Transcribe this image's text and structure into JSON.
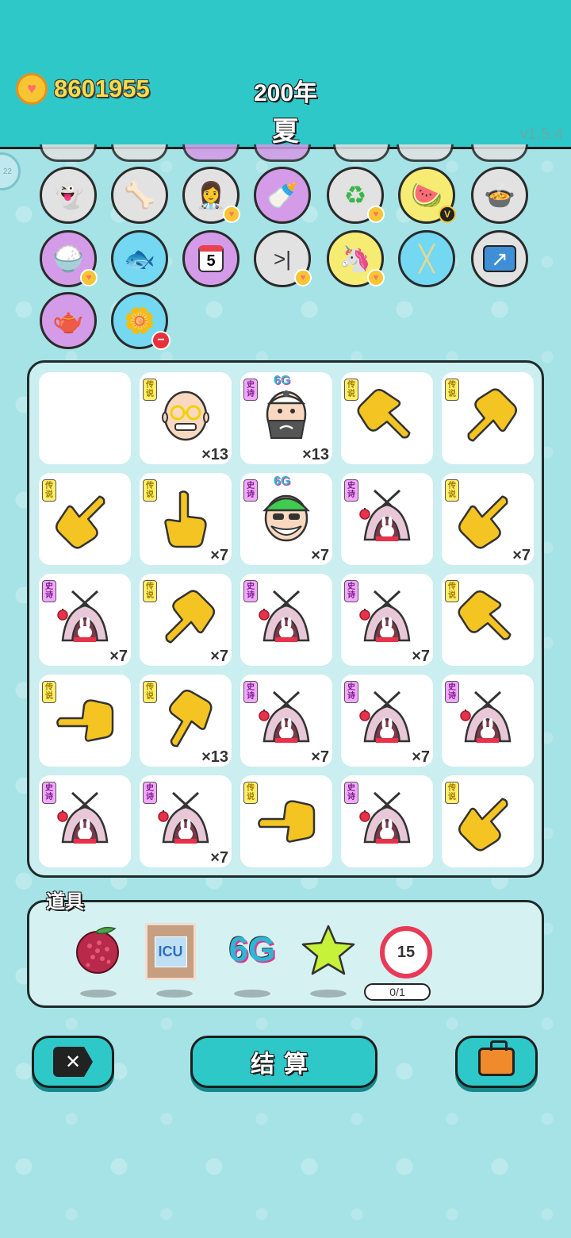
{
  "header": {
    "coins": "8601955",
    "year": "200年",
    "season": "夏",
    "version": "v1.5.4"
  },
  "side_badge": "22",
  "upgrades": [
    {
      "name": "ghost-icon",
      "glyph": "👻",
      "bg": "#e2e2e2",
      "badge": ""
    },
    {
      "name": "dog-bowl-icon",
      "glyph": "🦴",
      "bg": "#e2e2e2",
      "badge": ""
    },
    {
      "name": "nurses-icon",
      "glyph": "👩‍⚕️",
      "bg": "#e2e2e2",
      "badge": "heart"
    },
    {
      "name": "baby-bottle-icon",
      "glyph": "🍼",
      "bg": "#d49be8",
      "badge": ""
    },
    {
      "name": "recycle-icon",
      "glyph": "♻",
      "bg": "#e2e2e2",
      "badge": "heart"
    },
    {
      "name": "fruit-bowl-icon",
      "glyph": "🍉",
      "bg": "#f6ec73",
      "badge": "v"
    },
    {
      "name": "cooking-pot-icon",
      "glyph": "🍲",
      "bg": "#e2e2e2",
      "badge": ""
    },
    {
      "name": "rice-bowl-icon",
      "glyph": "🍚",
      "bg": "#d49be8",
      "badge": "heart"
    },
    {
      "name": "fish-tank-icon",
      "glyph": "🐟",
      "bg": "#74d8f2",
      "badge": ""
    },
    {
      "name": "calendar-icon",
      "glyph": "5",
      "bg": "#d49be8",
      "badge": ""
    },
    {
      "name": "skip-icon",
      "glyph": ">|",
      "bg": "#e2e2e2",
      "badge": "heart"
    },
    {
      "name": "unicorn-icon",
      "glyph": "🦄",
      "bg": "#f6ec73",
      "badge": "heart"
    },
    {
      "name": "chopsticks-icon",
      "glyph": "╳",
      "bg": "#74d8f2",
      "badge": ""
    },
    {
      "name": "arrow-up-box-icon",
      "glyph": "↗",
      "bg": "#e2e2e2",
      "badge": ""
    },
    {
      "name": "gravy-boat-icon",
      "glyph": "🫖",
      "bg": "#d49be8",
      "badge": ""
    },
    {
      "name": "flower-pot-icon",
      "glyph": "🌼",
      "bg": "#74d8f2",
      "badge": "minus"
    }
  ],
  "grid": [
    {
      "type": "empty",
      "rarity": "",
      "six_g": "",
      "count": ""
    },
    {
      "type": "grandpa",
      "rarity": "传说",
      "six_g": "",
      "count": "×13"
    },
    {
      "type": "bearded-man",
      "rarity": "史诗",
      "six_g": "6G",
      "count": "×13"
    },
    {
      "type": "hand-down-right",
      "rarity": "传说",
      "six_g": "",
      "count": ""
    },
    {
      "type": "hand-left-down",
      "rarity": "传说",
      "six_g": "",
      "count": ""
    },
    {
      "type": "hand-up-right",
      "rarity": "传说",
      "six_g": "",
      "count": ""
    },
    {
      "type": "hand-up",
      "rarity": "传说",
      "six_g": "",
      "count": "×7"
    },
    {
      "type": "green-hat-man",
      "rarity": "史诗",
      "six_g": "6G",
      "count": "×7"
    },
    {
      "type": "bunny-tent",
      "rarity": "史诗",
      "six_g": "",
      "count": ""
    },
    {
      "type": "hand-up-right",
      "rarity": "传说",
      "six_g": "",
      "count": "×7"
    },
    {
      "type": "bunny-tent",
      "rarity": "史诗",
      "six_g": "",
      "count": "×7"
    },
    {
      "type": "hand-left-down",
      "rarity": "传说",
      "six_g": "",
      "count": "×7"
    },
    {
      "type": "bunny-tent",
      "rarity": "史诗",
      "six_g": "",
      "count": ""
    },
    {
      "type": "bunny-tent",
      "rarity": "史诗",
      "six_g": "",
      "count": "×7"
    },
    {
      "type": "hand-down-right",
      "rarity": "传说",
      "six_g": "",
      "count": ""
    },
    {
      "type": "hand-left",
      "rarity": "传说",
      "six_g": "",
      "count": ""
    },
    {
      "type": "hand-down-left",
      "rarity": "传说",
      "six_g": "",
      "count": "×13"
    },
    {
      "type": "bunny-tent",
      "rarity": "史诗",
      "six_g": "",
      "count": "×7"
    },
    {
      "type": "bunny-tent",
      "rarity": "史诗",
      "six_g": "",
      "count": "×7"
    },
    {
      "type": "bunny-tent",
      "rarity": "史诗",
      "six_g": "",
      "count": ""
    },
    {
      "type": "bunny-tent",
      "rarity": "史诗",
      "six_g": "",
      "count": ""
    },
    {
      "type": "bunny-tent",
      "rarity": "史诗",
      "six_g": "",
      "count": "×7"
    },
    {
      "type": "hand-left",
      "rarity": "传说",
      "six_g": "",
      "count": ""
    },
    {
      "type": "bunny-tent",
      "rarity": "史诗",
      "six_g": "",
      "count": ""
    },
    {
      "type": "hand-up-right",
      "rarity": "传说",
      "six_g": "",
      "count": ""
    }
  ],
  "items": {
    "label": "道具",
    "list": [
      {
        "name": "bayberry-icon"
      },
      {
        "name": "icu-icon",
        "text": "ICU"
      },
      {
        "name": "six-g-icon",
        "text": "6G"
      },
      {
        "name": "star-icon"
      },
      {
        "name": "timer-icon",
        "text": "15",
        "counter": "0/1"
      }
    ]
  },
  "buttons": {
    "exit": "",
    "settle": "结算",
    "bag": ""
  },
  "colors": {
    "header": "#2ec8c8",
    "background": "#a6e3e6",
    "coin_text": "#f9dc4a"
  }
}
